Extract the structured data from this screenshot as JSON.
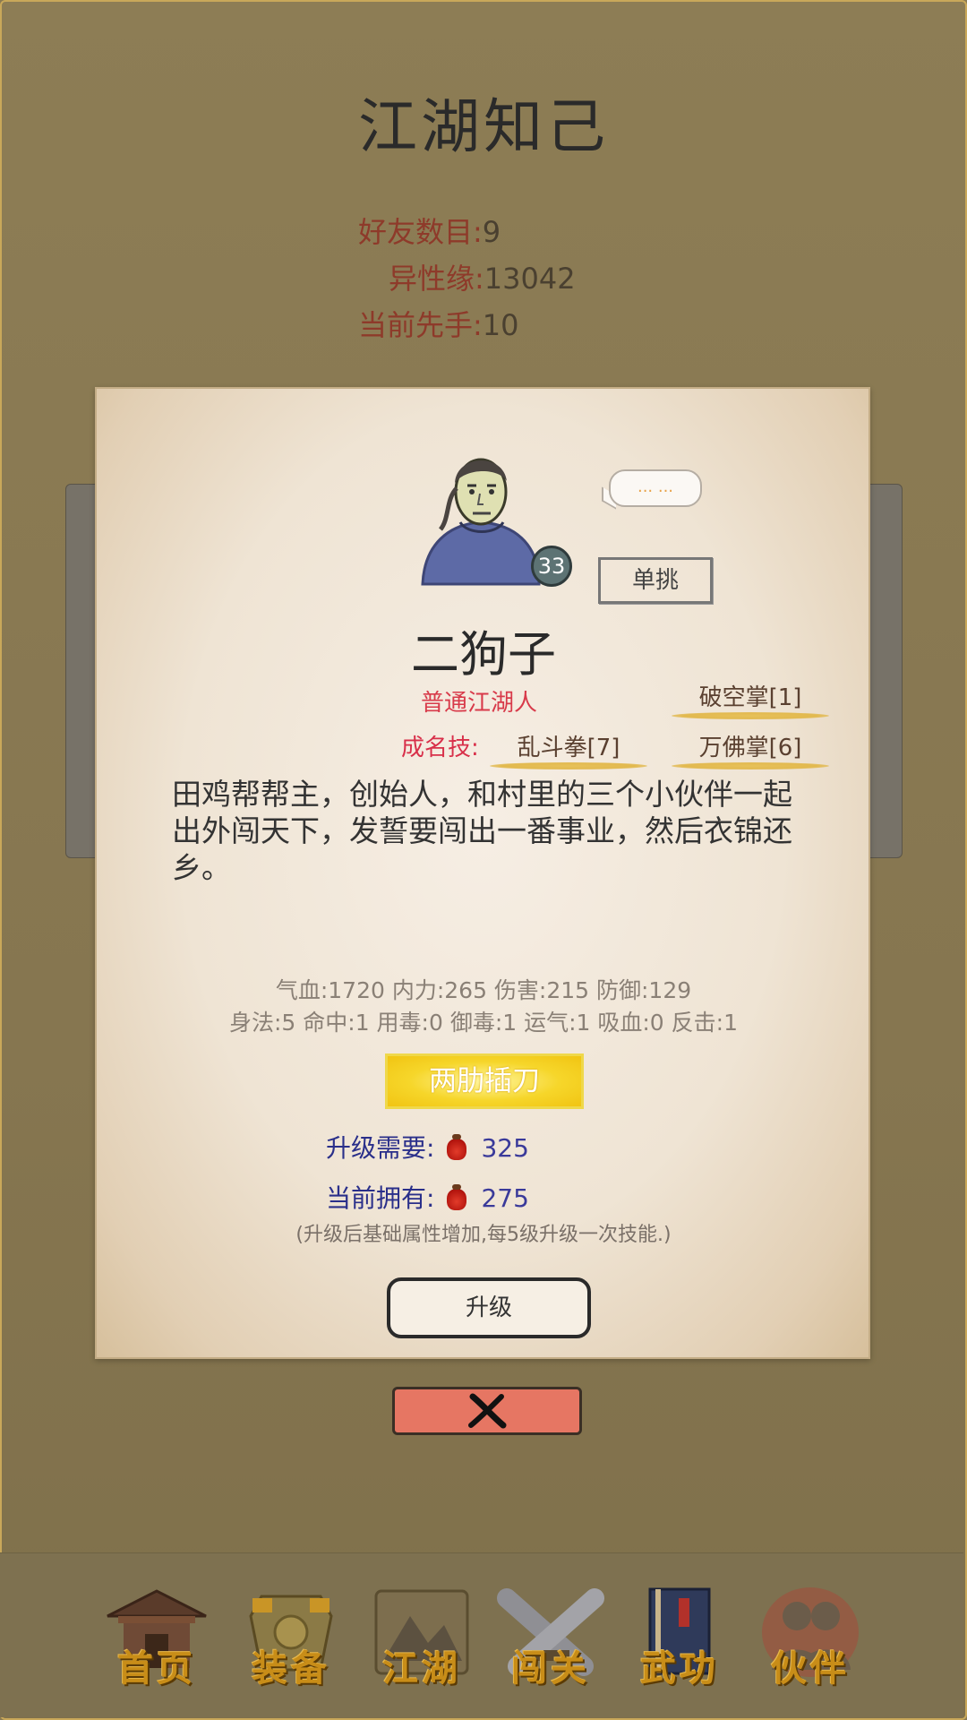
{
  "header": {
    "title": "江湖知己"
  },
  "stats": [
    {
      "label": "好友数目:",
      "value": "9"
    },
    {
      "label": "异性缘:",
      "value": "13042"
    },
    {
      "label": "当前先手:",
      "value": "10"
    }
  ],
  "character": {
    "level": "33",
    "speech": "... ...",
    "duel_label": "单挑",
    "name": "二狗子",
    "rank": "普通江湖人",
    "signature_label": "成名技:",
    "skills": [
      "破空掌[1]",
      "乱斗拳[7]",
      "万佛掌[6]"
    ],
    "description": "田鸡帮帮主，创始人，和村里的三个小伙伴一起出外闯天下，发誓要闯出一番事业，然后衣锦还乡。",
    "attrs_line1": "气血:1720  内力:265  伤害:215  防御:129",
    "attrs_line2": "身法:5  命中:1  用毒:0  御毒:1  运气:1  吸血:0  反击:1",
    "talent": "两肋插刀"
  },
  "upgrade": {
    "need_label": "升级需要:",
    "need_value": "325",
    "have_label": "当前拥有:",
    "have_value": "275",
    "note": "(升级后基础属性增加,每5级升级一次技能.)",
    "button_label": "升级"
  },
  "nav": [
    {
      "label": "首页",
      "icon": "house-icon"
    },
    {
      "label": "装备",
      "icon": "armor-icon"
    },
    {
      "label": "江湖",
      "icon": "scroll-map-icon"
    },
    {
      "label": "闯关",
      "icon": "crossed-swords-icon"
    },
    {
      "label": "武功",
      "icon": "book-icon"
    },
    {
      "label": "伙伴",
      "icon": "partners-icon"
    }
  ],
  "colors": {
    "background": "#8a7a52",
    "close": "#e67663",
    "accent_gold": "#c88d18"
  }
}
